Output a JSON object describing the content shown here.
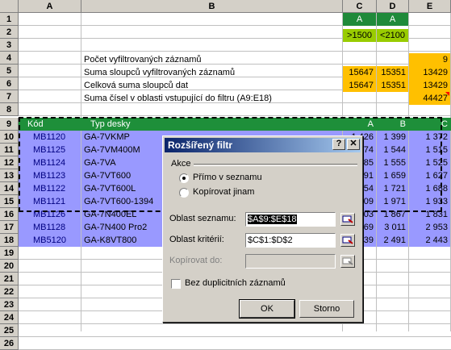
{
  "columns": [
    "A",
    "B",
    "C",
    "D",
    "E"
  ],
  "rows": [
    "1",
    "2",
    "3",
    "4",
    "5",
    "6",
    "7",
    "8",
    "9",
    "10",
    "11",
    "12",
    "13",
    "14",
    "15",
    "16",
    "17",
    "18",
    "19",
    "20",
    "21",
    "22",
    "23",
    "24",
    "25",
    "26"
  ],
  "criteria": {
    "c1": "A",
    "d1": "A",
    "c2": ">1500",
    "d2": "<2100"
  },
  "summary": {
    "b4": "Počet vyfiltrovaných záznamů",
    "e4": "9",
    "b5": "Suma sloupců vyfiltrovaných záznamů",
    "c5": "15647",
    "d5": "15351",
    "e5": "13429",
    "b6": "Celková suma sloupců dat",
    "c6": "15647",
    "d6": "15351",
    "e6": "13429",
    "b7": "Suma čísel v oblasti vstupující do filtru (A9:E18)",
    "e7": "44427"
  },
  "table": {
    "headers": [
      "Kód",
      "Typ desky",
      "A",
      "B",
      "C"
    ],
    "rows": [
      [
        "MB1120",
        "GA-7VKMP",
        "1 426",
        "1 399",
        "1 372"
      ],
      [
        "MB1125",
        "GA-7VM400M",
        "1 574",
        "1 544",
        "1 515"
      ],
      [
        "MB1124",
        "GA-7VA",
        "1 585",
        "1 555",
        "1 525"
      ],
      [
        "MB1123",
        "GA-7VT600",
        "1 691",
        "1 659",
        "1 627"
      ],
      [
        "MB1122",
        "GA-7VT600L",
        "1 754",
        "1 721",
        "1 688"
      ],
      [
        "MB1121",
        "GA-7VT600-1394",
        "2 009",
        "1 971",
        "1 933"
      ],
      [
        "MB1126",
        "GA-7N400EL",
        "1 903",
        "1 867",
        "1 831"
      ],
      [
        "MB1128",
        "GA-7N400 Pro2",
        "3 069",
        "3 011",
        "2 953"
      ],
      [
        "MB5120",
        "GA-K8VT800",
        "2 539",
        "2 491",
        "2 443"
      ]
    ]
  },
  "dialog": {
    "title": "Rozšířený filtr",
    "help": "?",
    "close": "✕",
    "group_label": "Akce",
    "radio1": "Přímo v seznamu",
    "radio2": "Kopírovat jinam",
    "list_range_label": "Oblast seznamu:",
    "list_range_value": "$A$9:$E$18",
    "criteria_label": "Oblast kritérií:",
    "criteria_value": "$C$1:$D$2",
    "copy_to_label": "Kopírovat do:",
    "copy_to_value": "",
    "unique_label": "Bez duplicitních záznamů",
    "ok": "OK",
    "cancel": "Storno"
  },
  "colors": {
    "header_green": "#1f8a3a",
    "criteria_lime": "#99cc00",
    "sum_orange": "#ffc000",
    "row_blue": "#9999ff"
  }
}
